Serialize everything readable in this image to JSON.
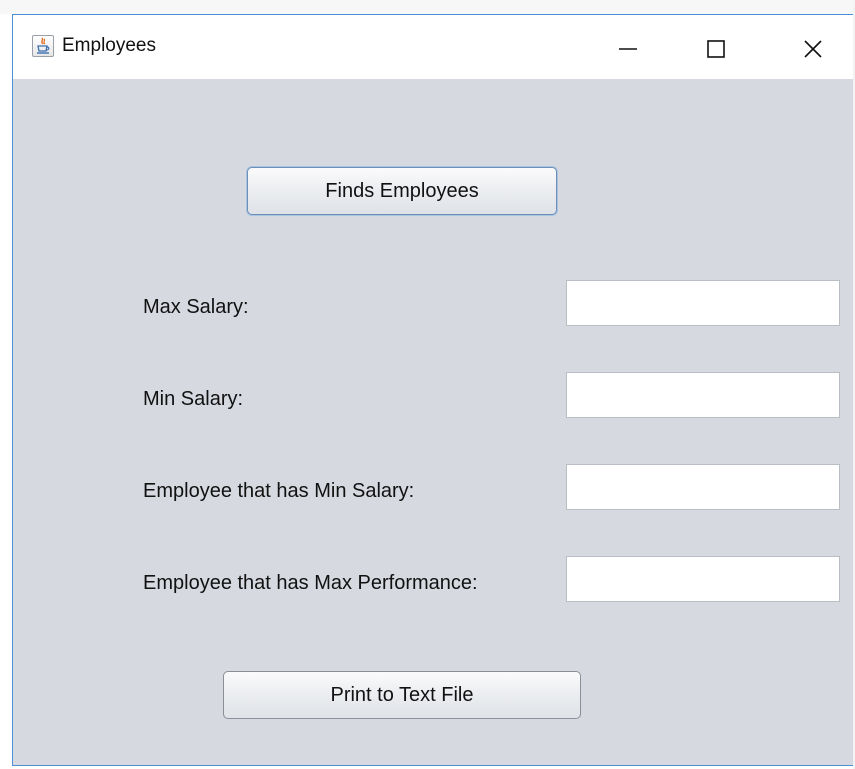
{
  "window": {
    "title": "Employees",
    "icon": "java-cup-icon",
    "controls": {
      "minimize": "minimize-icon",
      "maximize": "maximize-icon",
      "close": "close-icon"
    }
  },
  "form": {
    "find_button": "Finds Employees",
    "fields": [
      {
        "label": "Max Salary:",
        "value": ""
      },
      {
        "label": "Min Salary:",
        "value": ""
      },
      {
        "label": "Employee that has Min Salary:",
        "value": ""
      },
      {
        "label": "Employee that has Max Performance:",
        "value": ""
      }
    ],
    "print_button": "Print to Text File"
  },
  "colors": {
    "window_bg": "#d6d9e0",
    "border_accent": "#4a8fd6"
  }
}
